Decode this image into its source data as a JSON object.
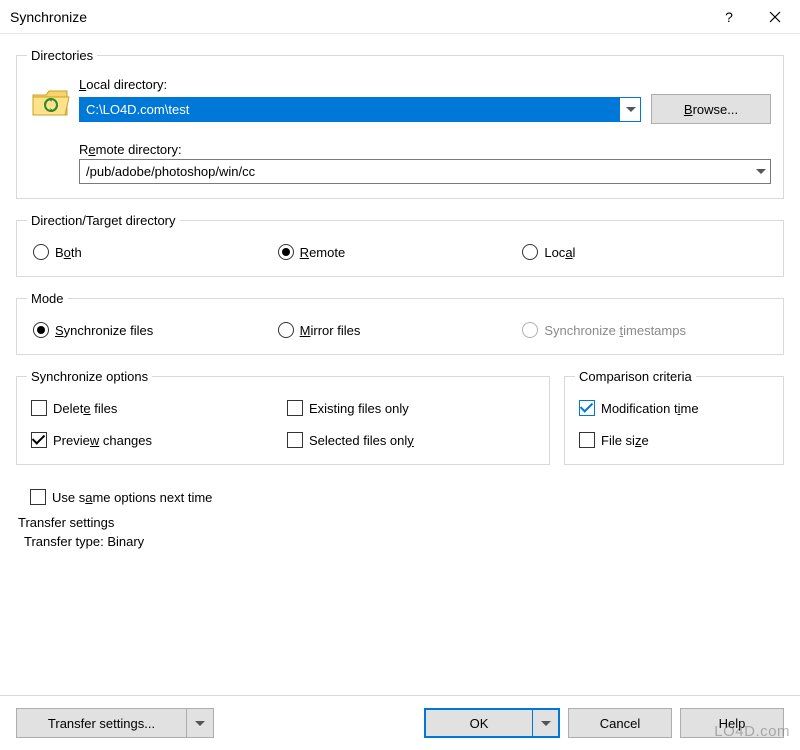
{
  "window": {
    "title": "Synchronize"
  },
  "directories": {
    "legend": "Directories",
    "local_label": "Local directory:",
    "local_value": "C:\\LO4D.com\\test",
    "browse_label": "Browse...",
    "remote_label": "Remote directory:",
    "remote_value": "/pub/adobe/photoshop/win/cc"
  },
  "direction": {
    "legend": "Direction/Target directory",
    "options": {
      "both": "Both",
      "remote": "Remote",
      "local": "Local"
    },
    "selected": "remote"
  },
  "mode": {
    "legend": "Mode",
    "options": {
      "sync": "Synchronize files",
      "mirror": "Mirror files",
      "timestamps": "Synchronize timestamps"
    },
    "selected": "sync"
  },
  "sync_options": {
    "legend": "Synchronize options",
    "delete": {
      "label": "Delete files",
      "checked": false
    },
    "existing": {
      "label": "Existing files only",
      "checked": false
    },
    "preview": {
      "label": "Preview changes",
      "checked": true
    },
    "selected": {
      "label": "Selected files only",
      "checked": false
    }
  },
  "criteria": {
    "legend": "Comparison criteria",
    "mtime": {
      "label": "Modification time",
      "checked": true
    },
    "size": {
      "label": "File size",
      "checked": false
    }
  },
  "same_options": {
    "label": "Use same options next time",
    "checked": false
  },
  "transfer": {
    "heading": "Transfer settings",
    "line": "Transfer type: Binary"
  },
  "footer": {
    "transfer_settings": "Transfer settings...",
    "ok": "OK",
    "cancel": "Cancel",
    "help": "Help"
  },
  "watermark": "LO4D.com"
}
